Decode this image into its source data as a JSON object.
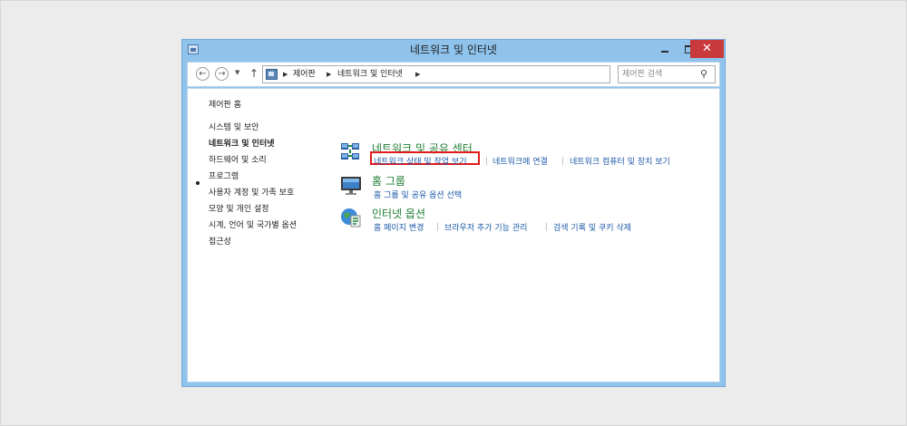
{
  "window": {
    "title": "네트워크 및 인터넷"
  },
  "titlebar": {
    "close_glyph": "✕"
  },
  "address": {
    "crumbs": [
      "제어판",
      "네트워크 및 인터넷"
    ],
    "back_glyph": "←",
    "forward_glyph": "→",
    "recent_glyph": "▼",
    "up_glyph": "↑",
    "dropdown_glyph": "∨",
    "refresh_glyph": "↻",
    "sep_glyph": "▶",
    "search_placeholder": "제어판 검색",
    "search_glyph": "⚲"
  },
  "sidebar": {
    "home": "제어판 홈",
    "items": [
      "시스템 및 보안",
      "네트워크 및 인터넷",
      "하드웨어 및 소리",
      "프로그램",
      "사용자 계정 및 가족 보호",
      "모양 및 개인 설정",
      "시계, 언어 및 국가별 옵션",
      "접근성"
    ],
    "active_index": 1
  },
  "categories": [
    {
      "title": "네트워크 및 공유 센터",
      "links": [
        "네트워크 상태 및 작업 보기",
        "네트워크에 연결",
        "네트워크 컴퓨터 및 장치 보기"
      ],
      "icon": "network-sharing-icon"
    },
    {
      "title": "홈 그룹",
      "links": [
        "홈 그룹 및 공유 옵션 선택"
      ],
      "icon": "homegroup-icon"
    },
    {
      "title": "인터넷 옵션",
      "links": [
        "홈 페이지 변경",
        "브라우저 추가 기능 관리",
        "검색 기록 및 쿠키 삭제"
      ],
      "icon": "internet-options-icon"
    }
  ],
  "colors": {
    "frame": "#8fc3ec",
    "category_title": "#1e7d34",
    "link": "#1d5aa8",
    "highlight": "#e01b1b",
    "close_button": "#c7393a"
  }
}
